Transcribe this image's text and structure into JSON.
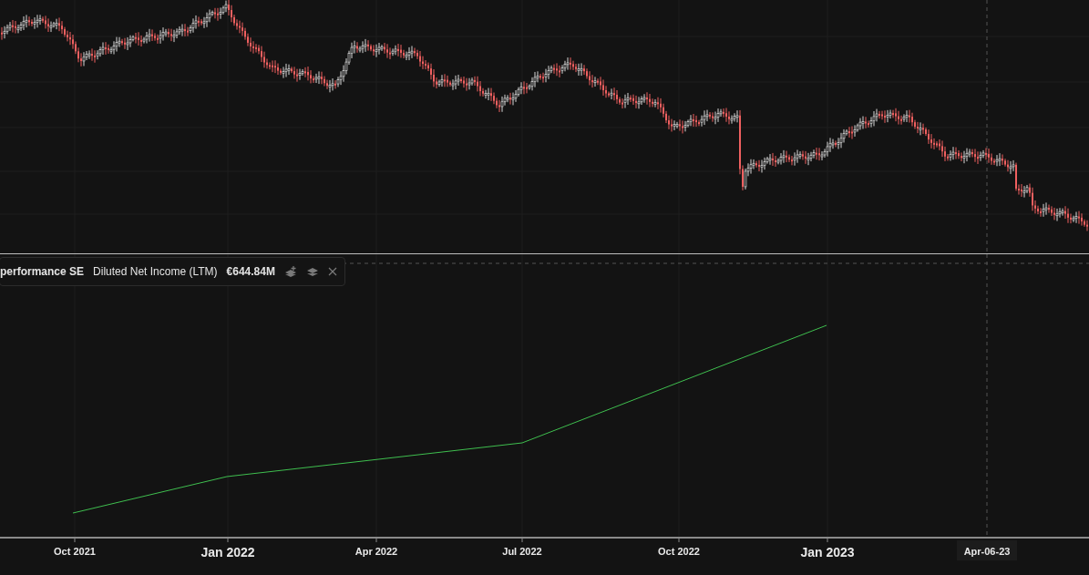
{
  "legend": {
    "company": "performance SE",
    "metric": "Diluted Net Income (LTM)",
    "value": "€644.84M"
  },
  "x_axis": {
    "labels": [
      {
        "text": "Oct 2021",
        "major": false
      },
      {
        "text": "Jan 2022",
        "major": true
      },
      {
        "text": "Apr 2022",
        "major": false
      },
      {
        "text": "Jul 2022",
        "major": false
      },
      {
        "text": "Oct 2022",
        "major": false
      },
      {
        "text": "Jan 2023",
        "major": true
      }
    ],
    "crosshair_label": "Apr-06-23"
  }
}
